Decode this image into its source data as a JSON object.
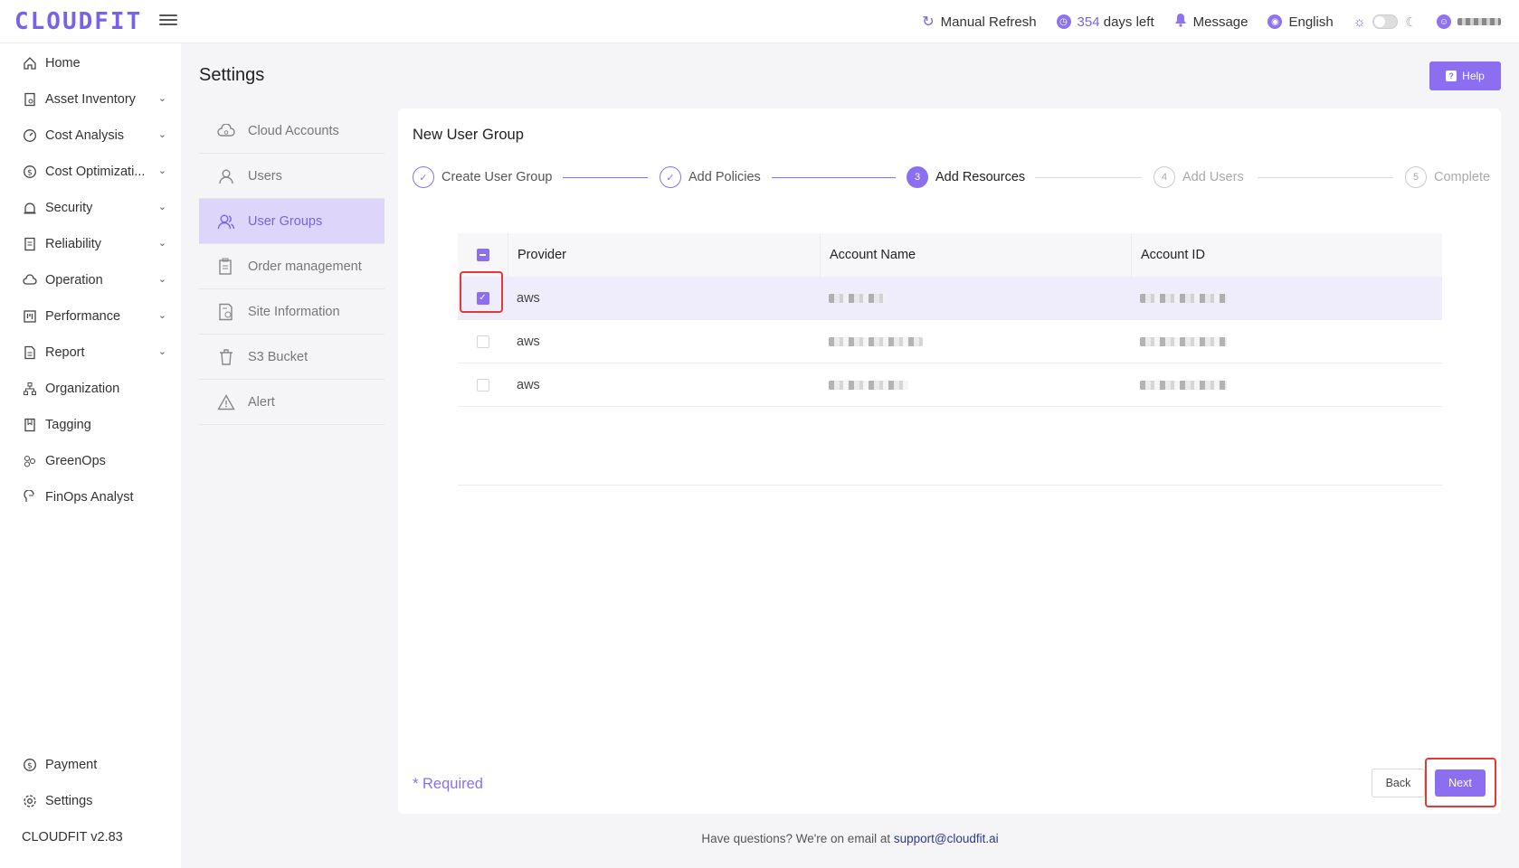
{
  "app": {
    "logo": "CLOUDFIT",
    "version": "CLOUDFIT v2.83"
  },
  "topbar": {
    "refresh_label": "Manual Refresh",
    "days_number": "354",
    "days_suffix": " days left",
    "message_label": "Message",
    "language_label": "English",
    "theme": "light"
  },
  "sidebar": {
    "items": [
      {
        "label": "Home",
        "icon": "home-icon",
        "expandable": false
      },
      {
        "label": "Asset Inventory",
        "icon": "inventory-icon",
        "expandable": true
      },
      {
        "label": "Cost Analysis",
        "icon": "gauge-icon",
        "expandable": true
      },
      {
        "label": "Cost Optimizati...",
        "icon": "dollar-icon",
        "expandable": true
      },
      {
        "label": "Security",
        "icon": "alarm-icon",
        "expandable": true
      },
      {
        "label": "Reliability",
        "icon": "document-icon",
        "expandable": true
      },
      {
        "label": "Operation",
        "icon": "cloud-cog-icon",
        "expandable": true
      },
      {
        "label": "Performance",
        "icon": "board-icon",
        "expandable": true
      },
      {
        "label": "Report",
        "icon": "report-icon",
        "expandable": true
      },
      {
        "label": "Organization",
        "icon": "org-icon",
        "expandable": false
      },
      {
        "label": "Tagging",
        "icon": "bookmark-icon",
        "expandable": false
      },
      {
        "label": "GreenOps",
        "icon": "leaf-icon",
        "expandable": false
      },
      {
        "label": "FinOps Analyst",
        "icon": "brain-icon",
        "expandable": false
      }
    ],
    "bottom": [
      {
        "label": "Payment",
        "icon": "dollar-icon"
      },
      {
        "label": "Settings",
        "icon": "gear-icon"
      }
    ]
  },
  "page": {
    "title": "Settings",
    "help_label": "Help"
  },
  "settings_menu": [
    {
      "label": "Cloud Accounts",
      "icon": "cloud-icon",
      "active": false
    },
    {
      "label": "Users",
      "icon": "user-icon",
      "active": false
    },
    {
      "label": "User Groups",
      "icon": "user-group-icon",
      "active": true
    },
    {
      "label": "Order management",
      "icon": "clipboard-icon",
      "active": false
    },
    {
      "label": "Site Information",
      "icon": "site-info-icon",
      "active": false
    },
    {
      "label": "S3 Bucket",
      "icon": "bucket-icon",
      "active": false
    },
    {
      "label": "Alert",
      "icon": "warning-icon",
      "active": false
    }
  ],
  "card": {
    "title": "New User Group",
    "steps": [
      {
        "num": "1",
        "label": "Create User Group",
        "status": "done"
      },
      {
        "num": "2",
        "label": "Add Policies",
        "status": "done"
      },
      {
        "num": "3",
        "label": "Add Resources",
        "status": "current"
      },
      {
        "num": "4",
        "label": "Add Users",
        "status": "todo"
      },
      {
        "num": "5",
        "label": "Complete",
        "status": "todo"
      }
    ],
    "table": {
      "columns": [
        "Provider",
        "Account Name",
        "Account ID"
      ],
      "rows": [
        {
          "provider": "aws",
          "checked": true
        },
        {
          "provider": "aws",
          "checked": false
        },
        {
          "provider": "aws",
          "checked": false
        }
      ]
    },
    "required_label": "* Required",
    "back_label": "Back",
    "next_label": "Next"
  },
  "footer": {
    "text": "Have questions? We're on email at ",
    "email": "support@cloudfit.ai"
  },
  "colors": {
    "accent": "#8b6ff0",
    "highlight": "#e53935"
  }
}
